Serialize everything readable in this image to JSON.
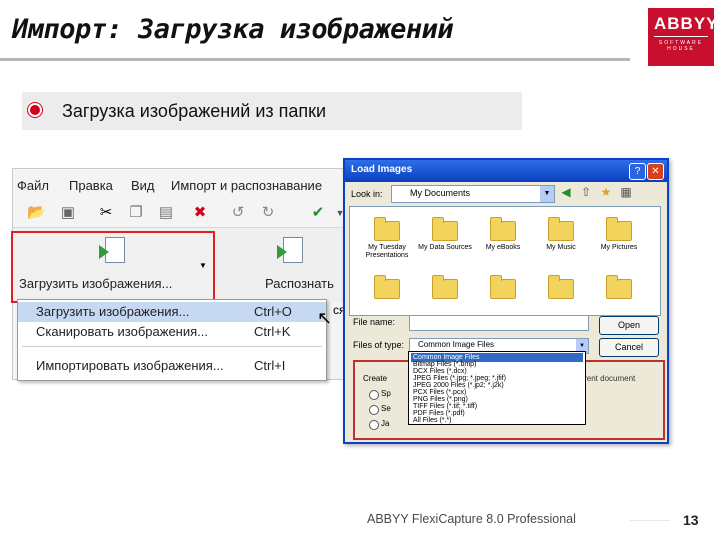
{
  "slide": {
    "title": "Импорт: Загрузка изображений",
    "bullet": "Загрузка изображений из папки",
    "footer": "ABBYY FlexiCapture 8.0 Professional",
    "page_number": "13"
  },
  "logo": {
    "name": "ABBYY",
    "tagline": "SOFTWARE HOUSE",
    "color": "#c8102e"
  },
  "app": {
    "menu": [
      "Файл",
      "Правка",
      "Вид",
      "Импорт и распознавание"
    ],
    "toolbar_icons": [
      "open-folder-icon",
      "save-icon",
      "cut-icon",
      "copy-icon",
      "paste-icon",
      "delete-icon",
      "undo-icon",
      "redo-icon",
      "check-icon",
      "more-icon"
    ],
    "load_button_label": "Загрузить изображения...",
    "recognize_button_label": "Распознать",
    "partial_text": "ся",
    "dropdown": [
      {
        "label": "Загрузить изображения...",
        "shortcut": "Ctrl+O"
      },
      {
        "label": "Сканировать изображения...",
        "shortcut": "Ctrl+K"
      },
      {
        "label": "Импортировать изображения...",
        "shortcut": "Ctrl+I"
      }
    ]
  },
  "dialog": {
    "title": "Load Images",
    "look_in_label": "Look in:",
    "look_in_value": "My Documents",
    "folders": [
      {
        "label": "My Tuesday Presentations"
      },
      {
        "label": "My Data Sources"
      },
      {
        "label": "My eBooks"
      },
      {
        "label": "My Music"
      },
      {
        "label": "My Pictures"
      },
      {
        "label": ""
      },
      {
        "label": ""
      },
      {
        "label": ""
      },
      {
        "label": ""
      },
      {
        "label": ""
      }
    ],
    "file_name_label": "File name:",
    "file_name_value": "",
    "files_of_type_label": "Files of type:",
    "files_of_type_value": "Common Image Files",
    "open_label": "Open",
    "cancel_label": "Cancel",
    "create_label": "Create",
    "document_label": "current document",
    "radio_labels": [
      "Sp",
      "Se",
      "Ja"
    ],
    "file_types": [
      "Common Image Files",
      "Bitmap Files (*.bmp)",
      "DCX Files (*.dcx)",
      "JPEG Files (*.jpg; *.jpeg; *.jfif)",
      "JPEG 2000 Files (*.jp2; *.j2k)",
      "PCX Files (*.pcx)",
      "PNG Files (*.png)",
      "TIFF Files (*.tif; *.tiff)",
      "PDF Files (*.pdf)",
      "All Files (*.*)"
    ]
  }
}
